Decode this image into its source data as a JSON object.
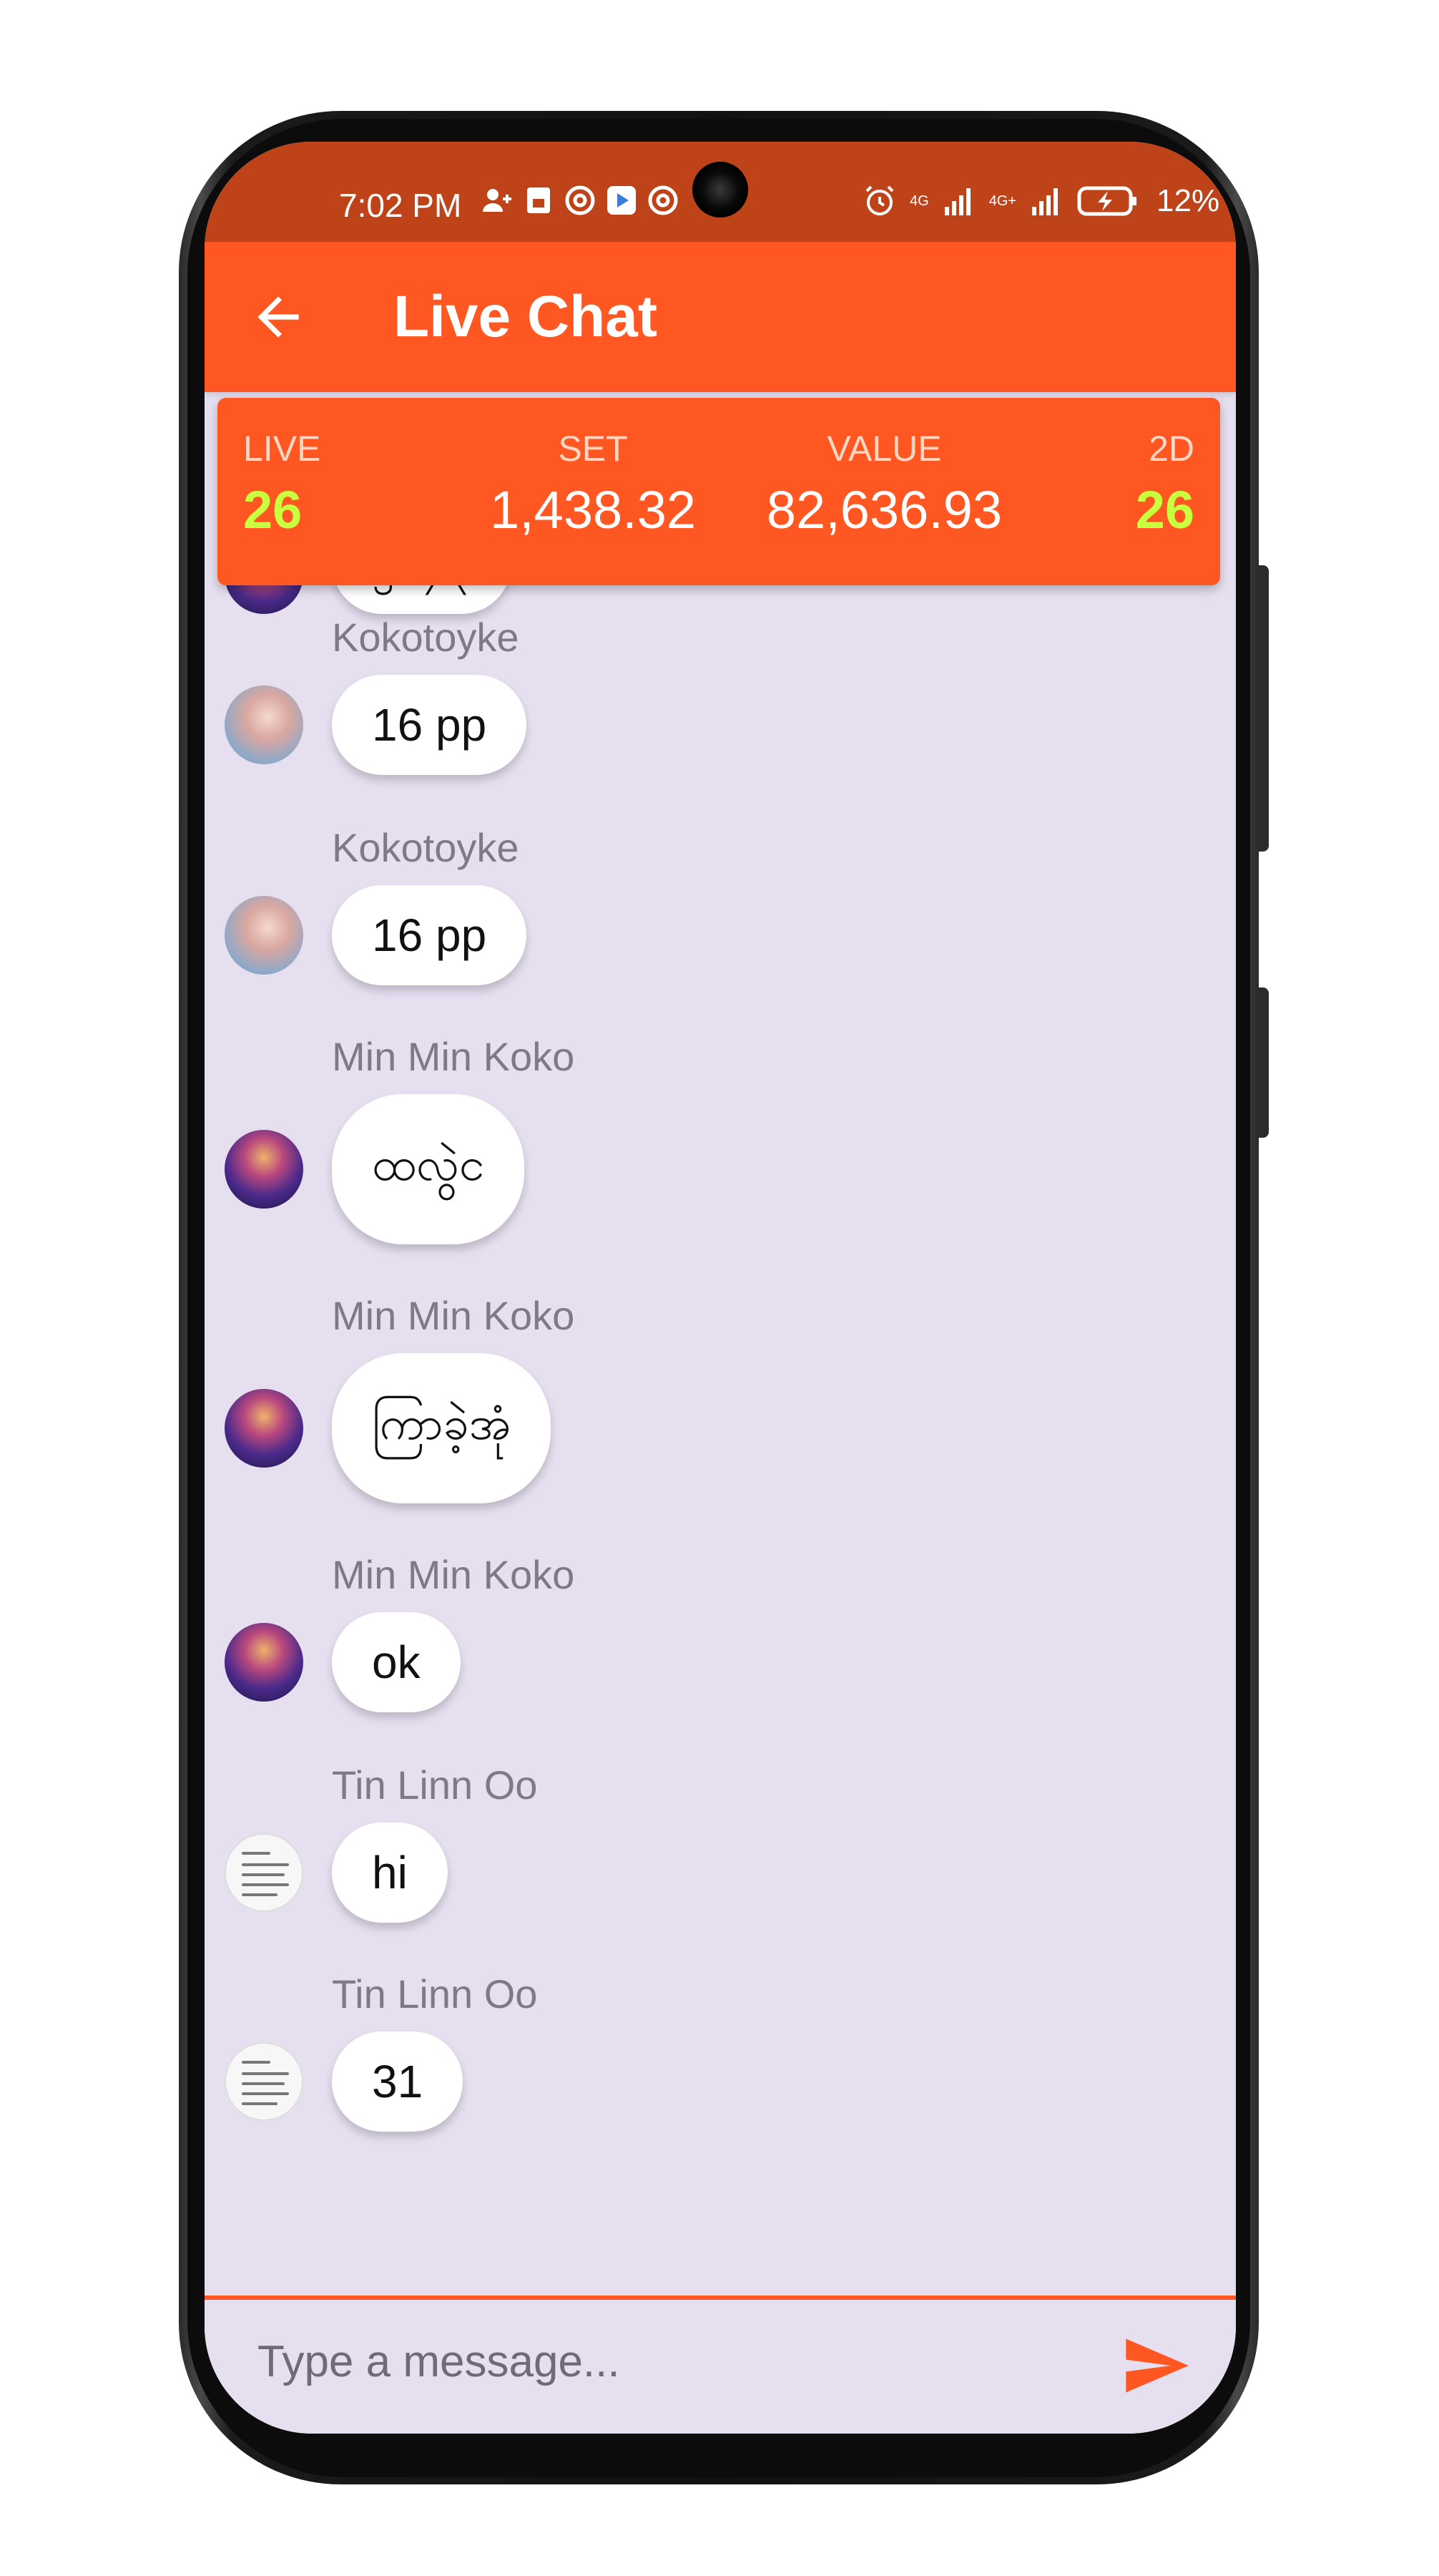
{
  "status_bar": {
    "time": "7:02 PM",
    "net_1": "4G",
    "net_2": "4G+",
    "battery": "12%",
    "icons": [
      "person-add-icon",
      "sim-icon",
      "at-icon",
      "play-store-icon",
      "at-icon",
      "alarm-icon",
      "signal-icon",
      "signal-icon",
      "battery-charging-icon"
    ]
  },
  "app_bar": {
    "title": "Live Chat",
    "back_icon": "arrow-left-icon"
  },
  "ticker": {
    "live_label": "LIVE",
    "live_value": "26",
    "set_label": "SET",
    "set_value": "1,438.32",
    "value_label": "VALUE",
    "value_value": "82,636.93",
    "twod_label": "2D",
    "twod_value": "26"
  },
  "messages": [
    {
      "sender": "",
      "text": "၂၁၄၃",
      "avatar": "purple"
    },
    {
      "sender": "Kokotoyke",
      "text": "16 pp",
      "avatar": "girl"
    },
    {
      "sender": "Kokotoyke",
      "text": "16 pp",
      "avatar": "girl"
    },
    {
      "sender": "Min Min Koko",
      "text": "ထလွဲင",
      "avatar": "purple"
    },
    {
      "sender": "Min Min Koko",
      "text": "ကြာခဲ့အုံ",
      "avatar": "purple"
    },
    {
      "sender": "Min Min Koko",
      "text": "ok",
      "avatar": "purple"
    },
    {
      "sender": "Tin Linn Oo",
      "text": "hi",
      "avatar": "text"
    },
    {
      "sender": "Tin Linn Oo",
      "text": "31",
      "avatar": "text"
    }
  ],
  "input": {
    "placeholder": "Type a message...",
    "value": "",
    "send_icon": "send-icon"
  },
  "colors": {
    "accent": "#ff5722",
    "status_bar": "#bf4319",
    "chat_bg": "#e6dff0",
    "highlight": "#c8ff3e"
  }
}
